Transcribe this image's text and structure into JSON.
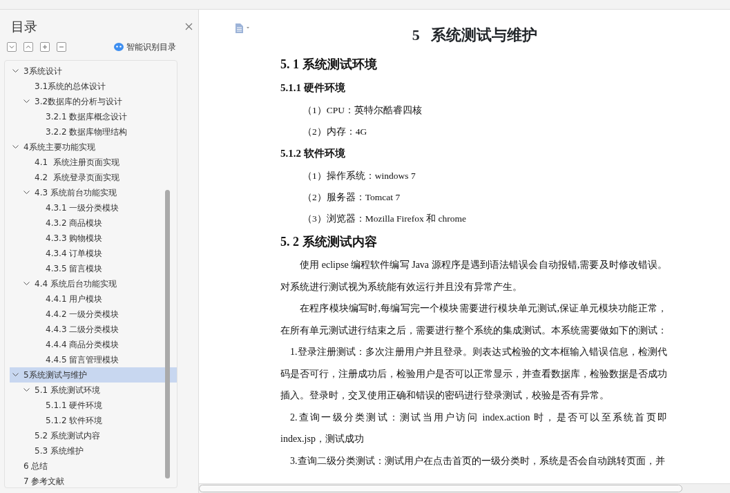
{
  "sidebar": {
    "title": "目录",
    "smart_toc": "智能识别目录",
    "tree": [
      {
        "label": "3系统设计",
        "expanded": true,
        "selected": false,
        "children": [
          {
            "label": "3.1系统的总体设计",
            "selected": false
          },
          {
            "label": "3.2数据库的分析与设计",
            "expanded": true,
            "selected": false,
            "children": [
              {
                "label": "3.2.1 数据库概念设计",
                "selected": false
              },
              {
                "label": "3.2.2 数据库物理结构",
                "selected": false
              }
            ]
          }
        ]
      },
      {
        "label": "4系统主要功能实现",
        "expanded": true,
        "selected": false,
        "children": [
          {
            "label": "4.1  系统注册页面实现",
            "selected": false
          },
          {
            "label": "4.2  系统登录页面实现",
            "selected": false
          },
          {
            "label": "4.3 系统前台功能实现",
            "expanded": true,
            "selected": false,
            "children": [
              {
                "label": "4.3.1 一级分类模块",
                "selected": false
              },
              {
                "label": "4.3.2 商品模块",
                "selected": false
              },
              {
                "label": "4.3.3 购物模块",
                "selected": false
              },
              {
                "label": "4.3.4 订单模块",
                "selected": false
              },
              {
                "label": "4.3.5 留言模块",
                "selected": false
              }
            ]
          },
          {
            "label": "4.4 系统后台功能实现",
            "expanded": true,
            "selected": false,
            "children": [
              {
                "label": "4.4.1 用户模块",
                "selected": false
              },
              {
                "label": "4.4.2 一级分类模块",
                "selected": false
              },
              {
                "label": "4.4.3 二级分类模块",
                "selected": false
              },
              {
                "label": "4.4.4 商品分类模块",
                "selected": false
              },
              {
                "label": "4.4.5 留言管理模块",
                "selected": false
              }
            ]
          }
        ]
      },
      {
        "label": "5系统测试与维护",
        "expanded": true,
        "selected": true,
        "children": [
          {
            "label": "5.1 系统测试环境",
            "expanded": true,
            "selected": false,
            "children": [
              {
                "label": "5.1.1 硬件环境",
                "selected": false
              },
              {
                "label": "5.1.2 软件环境",
                "selected": false
              }
            ]
          },
          {
            "label": "5.2 系统测试内容",
            "selected": false
          },
          {
            "label": "5.3 系统维护",
            "selected": false
          }
        ]
      },
      {
        "label": "6 总结",
        "selected": false
      },
      {
        "label": "7 参考文献",
        "selected": false
      }
    ]
  },
  "document": {
    "title": "5   系统测试与维护",
    "blocks": [
      {
        "kind": "h2",
        "text": "5. 1 系统测试环境"
      },
      {
        "kind": "h3",
        "text": "5.1.1 硬件环境"
      },
      {
        "kind": "item",
        "text": "（1）CPU：英特尔酷睿四核"
      },
      {
        "kind": "item",
        "text": "（2）内存：4G"
      },
      {
        "kind": "h3",
        "text": "5.1.2 软件环境"
      },
      {
        "kind": "item",
        "text": "（1）操作系统：windows 7"
      },
      {
        "kind": "item",
        "text": "（2）服务器：Tomcat 7"
      },
      {
        "kind": "item",
        "text": "（3）浏览器：Mozilla Firefox  和 chrome"
      },
      {
        "kind": "h2",
        "text": "5. 2 系统测试内容"
      },
      {
        "kind": "para",
        "text": "使用 eclipse 编程软件编写 Java 源程序是遇到语法错误会自动报错,需要及时修改错误。对系统进行测试视为系统能有效运行并且没有异常产生。"
      },
      {
        "kind": "para",
        "text": "在程序模块编写时,每编写完一个模块需要进行模块单元测试,保证单元模块功能正常，在所有单元测试进行结束之后，需要进行整个系统的集成测试。本系统需要做如下的测试："
      },
      {
        "kind": "numbered",
        "text": "1.登录注册测试：多次注册用户并且登录。则表达式检验的文本框输入错误信息，检测代码是否可行，注册成功后，检验用户是否可以正常显示，并查看数据库，检验数据是否成功插入。登录时，交叉使用正确和错误的密码进行登录测试，校验是否有异常。"
      },
      {
        "kind": "numbered",
        "text": "2.查询一级分类测试：测试当用户访问 index.action 时，是否可以至系统首页即 index.jsp，测试成功"
      },
      {
        "kind": "numbered",
        "text": "3.查询二级分类测试：测试用户在点击首页的一级分类时，系统是否会自动跳转页面，并"
      }
    ]
  }
}
